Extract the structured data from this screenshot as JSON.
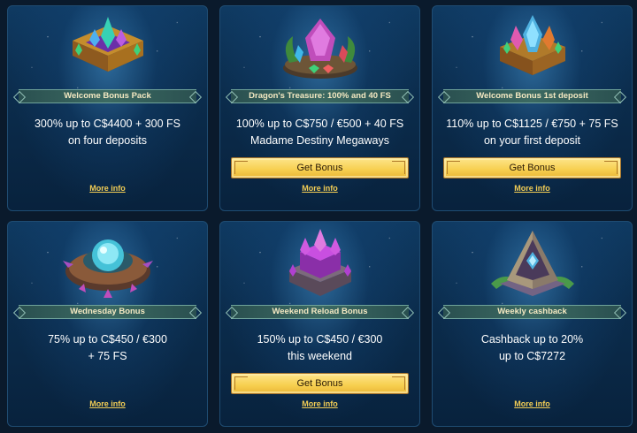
{
  "cards": [
    {
      "badge": "Welcome Bonus Pack",
      "offer_line1": "300% up to C$4400 + 300 FS",
      "offer_line2": "on four deposits",
      "button": "",
      "more_info": "More info",
      "art_icon": "gold-chest-crystals-icon",
      "accent": "#9b4fd9"
    },
    {
      "badge": "Dragon's Treasure: 100% and 40 FS",
      "offer_line1": "100% up to C$750 / €500 + 40 FS",
      "offer_line2": "Madame Destiny Megaways",
      "button": "Get Bonus",
      "more_info": "More info",
      "art_icon": "crystal-altar-icon",
      "accent": "#c04dbb"
    },
    {
      "badge": "Welcome Bonus 1st deposit",
      "offer_line1": "110% up to C$1125 / €750 + 75 FS",
      "offer_line2": "on your first deposit",
      "button": "Get Bonus",
      "more_info": "More info",
      "art_icon": "crystal-chest-icon",
      "accent": "#4fb1e0"
    },
    {
      "badge": "Wednesday Bonus",
      "offer_line1": "75% up to C$450 / €300",
      "offer_line2": "+ 75 FS",
      "button": "",
      "more_info": "More info",
      "art_icon": "blue-orb-crown-icon",
      "accent": "#45c2d8"
    },
    {
      "badge": "Weekend Reload Bonus",
      "offer_line1": "150% up to C$450 / €300",
      "offer_line2": "this weekend",
      "button": "Get Bonus",
      "more_info": "More info",
      "art_icon": "purple-crystal-tower-icon",
      "accent": "#c94fe0"
    },
    {
      "badge": "Weekly cashback",
      "offer_line1": "Cashback up to 20%",
      "offer_line2": "up to C$7272",
      "button": "",
      "more_info": "More info",
      "art_icon": "pyramid-gem-icon",
      "accent": "#7db5a2"
    }
  ]
}
